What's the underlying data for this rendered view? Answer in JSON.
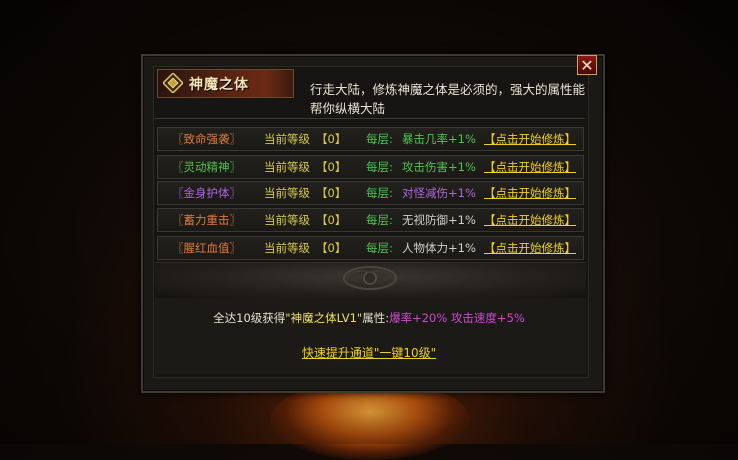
{
  "window": {
    "title": "神魔之体",
    "description": "行走大陆，修炼神魔之体是必须的，强大的属性能帮你纵横大陆",
    "close_label": "✕"
  },
  "colors": {
    "name_red": "#e0572c",
    "name_orange": "#e08a3a",
    "name_purple": "#b064e0",
    "name_yellow": "#e0c040",
    "name_green": "#4ec34e",
    "level_yellow": "#d6c84a",
    "per_green": "#4ec34e",
    "action_yellow": "#f0d020",
    "highlight_magenta": "#d04ad0"
  },
  "rows": [
    {
      "name": "〖致命强袭〗",
      "name_color": "#e07a3a",
      "level_label": "当前等级",
      "level_value": "【0】",
      "per_label": "每层:",
      "attr": "暴击几率+1%",
      "attr_color": "#4ec34e",
      "action": "【点击开始修炼】"
    },
    {
      "name": "〖灵动精神〗",
      "name_color": "#4ec34e",
      "level_label": "当前等级",
      "level_value": "【0】",
      "per_label": "每层:",
      "attr": "攻击伤害+1%",
      "attr_color": "#4ec34e",
      "action": "【点击开始修炼】"
    },
    {
      "name": "〖金身护体〗",
      "name_color": "#b064e0",
      "level_label": "当前等级",
      "level_value": "【0】",
      "per_label": "每层:",
      "attr": "对怪减伤+1%",
      "attr_color": "#b064e0",
      "action": "【点击开始修炼】"
    },
    {
      "name": "〖蓄力重击〗",
      "name_color": "#e07a3a",
      "level_label": "当前等级",
      "level_value": "【0】",
      "per_label": "每层:",
      "attr": "无视防御+1%",
      "attr_color": "#cfcfcf",
      "action": "【点击开始修炼】"
    },
    {
      "name": "〖腥红血值〗",
      "name_color": "#e07a3a",
      "level_label": "当前等级",
      "level_value": "【0】",
      "per_label": "每层:",
      "attr": "人物体力+1%",
      "attr_color": "#cfcfcf",
      "action": "【点击开始修炼】"
    }
  ],
  "summary": {
    "prefix": "全达10级获得",
    "title": "\"神魔之体LV1\"",
    "attr_label": "属性:",
    "bonus1": "爆率+20%",
    "bonus2": "攻击速度+5%"
  },
  "quick_link": "快速提升通道\"一键10级\""
}
